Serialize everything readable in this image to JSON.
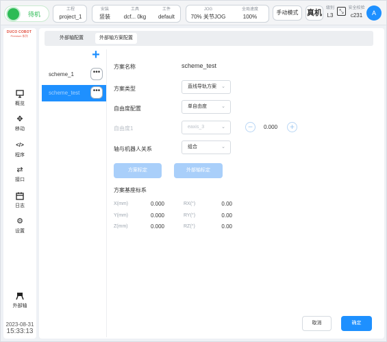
{
  "topbar": {
    "status": "待机",
    "project": {
      "caption": "工程",
      "value": "project_1"
    },
    "install": {
      "caption": "安装",
      "value": "竖装"
    },
    "tool": {
      "caption": "工具",
      "value": "dcf... 0kg"
    },
    "workpiece": {
      "caption": "工件",
      "value": "default"
    },
    "jog": {
      "caption": "JOG",
      "value": "70% 关节JOG"
    },
    "speed": {
      "caption": "全局速度",
      "value": "100%"
    },
    "mode_button": "手动模式",
    "real_button": "真机",
    "safety_level": {
      "caption": "级别",
      "value": "L3"
    },
    "checksum": {
      "caption": "安全校验",
      "value": "c231"
    },
    "avatar": "A",
    "colors": {
      "status_green": "#2dbb55",
      "accent": "#1e90ff"
    }
  },
  "brand": {
    "name": "DUCO COBOT",
    "sub": "Premium 系列"
  },
  "nav": [
    {
      "label": "概览",
      "icon": "monitor-icon"
    },
    {
      "label": "移动",
      "icon": "move-icon"
    },
    {
      "label": "程序",
      "icon": "code-icon"
    },
    {
      "label": "接口",
      "icon": "swap-icon"
    },
    {
      "label": "日志",
      "icon": "calendar-icon"
    },
    {
      "label": "设置",
      "icon": "gear-icon"
    },
    {
      "label": "外部轴",
      "icon": "external-axis-icon"
    }
  ],
  "datetime": {
    "date": "2023-08-31",
    "time": "15:33:13"
  },
  "tabs": {
    "axis_config": "外部轴配置",
    "scheme_config": "外部轴方案配置"
  },
  "schemes": [
    {
      "name": "scheme_1"
    },
    {
      "name": "scheme_test"
    }
  ],
  "form": {
    "scheme_name_label": "方案名称",
    "scheme_name_value": "scheme_test",
    "scheme_type_label": "方案类型",
    "scheme_type_value": "直线导轨方案",
    "dof_config_label": "自由度配置",
    "dof_config_value": "单自由度",
    "dof1_label": "自由度1",
    "dof1_axis": "eaxis_3",
    "dof1_value": "0.000",
    "relation_label": "轴与机器人关系",
    "relation_value": "组合",
    "btn_scheme_calib": "方案标定",
    "btn_axis_calib": "外部轴标定",
    "base_coord_label": "方案基座标系"
  },
  "coords": [
    {
      "name": "X(mm)",
      "value": "0.000",
      "rname": "RX(°)",
      "rvalue": "0.00"
    },
    {
      "name": "Y(mm)",
      "value": "0.000",
      "rname": "RY(°)",
      "rvalue": "0.00"
    },
    {
      "name": "Z(mm)",
      "value": "0.000",
      "rname": "RZ(°)",
      "rvalue": "0.00"
    }
  ],
  "footer": {
    "cancel": "取消",
    "confirm": "确定"
  }
}
